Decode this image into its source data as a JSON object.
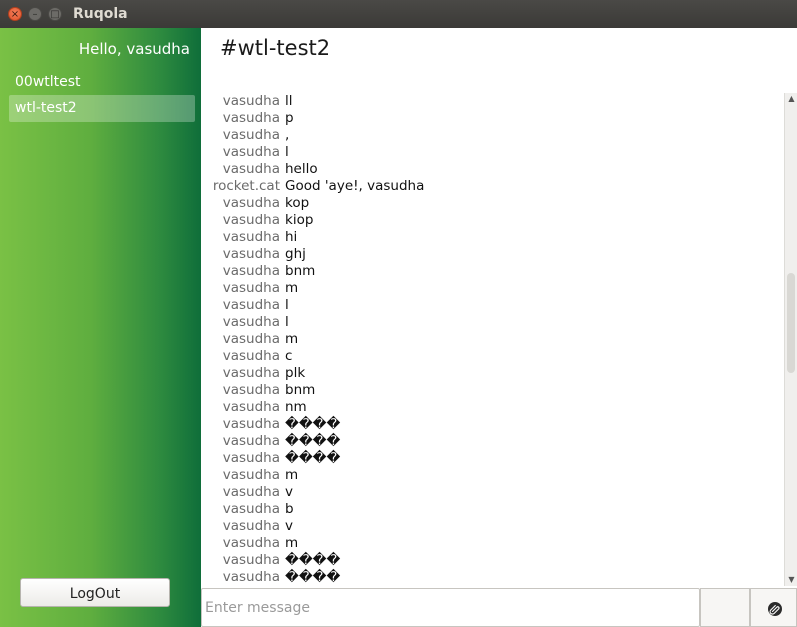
{
  "window": {
    "title": "Ruqola",
    "close_glyph": "×",
    "minimize_glyph": "–",
    "maximize_glyph": "□"
  },
  "sidebar": {
    "greeting": "Hello, vasudha",
    "rooms": [
      {
        "label": "00wtltest",
        "active": false
      },
      {
        "label": "wtl-test2",
        "active": true
      }
    ],
    "logout_label": "LogOut"
  },
  "channel": {
    "title": "#wtl-test2"
  },
  "messages": [
    {
      "user": "vasudha",
      "text": "ll"
    },
    {
      "user": "vasudha",
      "text": "p"
    },
    {
      "user": "vasudha",
      "text": ","
    },
    {
      "user": "vasudha",
      "text": "l"
    },
    {
      "user": "vasudha",
      "text": "hello"
    },
    {
      "user": "rocket.cat",
      "text": "Good 'aye!, vasudha"
    },
    {
      "user": "vasudha",
      "text": "kop"
    },
    {
      "user": "vasudha",
      "text": "kiop"
    },
    {
      "user": "vasudha",
      "text": "hi"
    },
    {
      "user": "vasudha",
      "text": "ghj"
    },
    {
      "user": "vasudha",
      "text": "bnm"
    },
    {
      "user": "vasudha",
      "text": "m"
    },
    {
      "user": "vasudha",
      "text": "l"
    },
    {
      "user": "vasudha",
      "text": "l"
    },
    {
      "user": "vasudha",
      "text": "m"
    },
    {
      "user": "vasudha",
      "text": "c"
    },
    {
      "user": "vasudha",
      "text": "plk"
    },
    {
      "user": "vasudha",
      "text": "bnm"
    },
    {
      "user": "vasudha",
      "text": "nm"
    },
    {
      "user": "vasudha",
      "text": "����"
    },
    {
      "user": "vasudha",
      "text": "����"
    },
    {
      "user": "vasudha",
      "text": "����"
    },
    {
      "user": "vasudha",
      "text": "m"
    },
    {
      "user": "vasudha",
      "text": "v"
    },
    {
      "user": "vasudha",
      "text": "b"
    },
    {
      "user": "vasudha",
      "text": "v"
    },
    {
      "user": "vasudha",
      "text": "m"
    },
    {
      "user": "vasudha",
      "text": "����"
    },
    {
      "user": "vasudha",
      "text": "����"
    }
  ],
  "composer": {
    "placeholder": "Enter message",
    "value": ""
  },
  "icons": {
    "attach": "paperclip-icon",
    "scroll_up": "arrow-up-icon",
    "scroll_down": "arrow-down-icon"
  },
  "colors": {
    "sidebar_gradient_start": "#7ac145",
    "sidebar_gradient_end": "#0f6e3a",
    "titlebar": "#3c3b37",
    "close_button": "#e9592f"
  }
}
